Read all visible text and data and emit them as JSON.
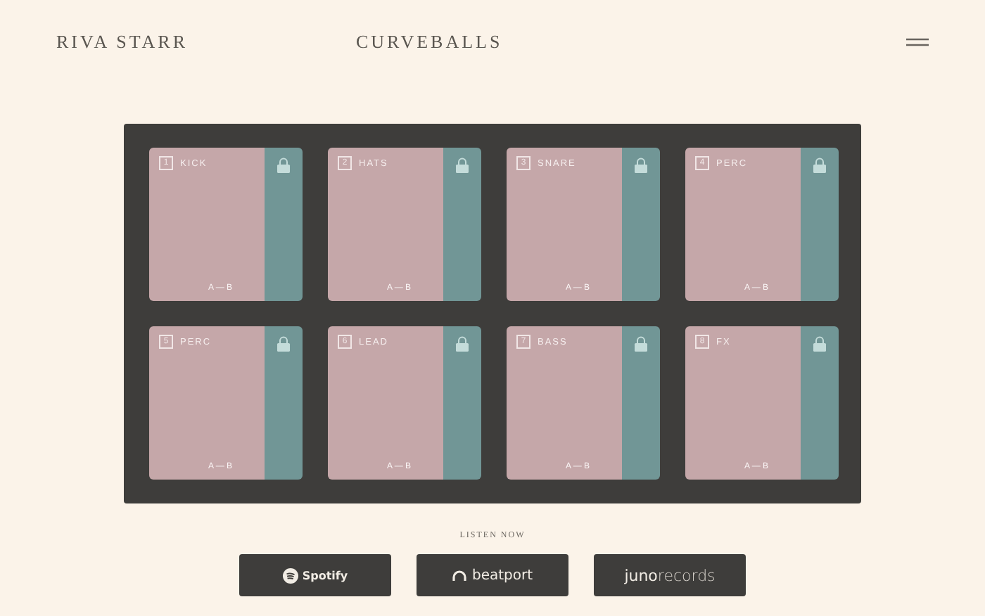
{
  "header": {
    "artist": "RIVA STARR",
    "title": "CURVEBALLS"
  },
  "pads": [
    {
      "number": "1",
      "label": "KICK",
      "footer": "A — B"
    },
    {
      "number": "2",
      "label": "HATS",
      "footer": "A — B"
    },
    {
      "number": "3",
      "label": "SNARE",
      "footer": "A — B"
    },
    {
      "number": "4",
      "label": "PERC",
      "footer": "A — B"
    },
    {
      "number": "5",
      "label": "PERC",
      "footer": "A — B"
    },
    {
      "number": "6",
      "label": "LEAD",
      "footer": "A — B"
    },
    {
      "number": "7",
      "label": "BASS",
      "footer": "A — B"
    },
    {
      "number": "8",
      "label": "FX",
      "footer": "A — B"
    }
  ],
  "listen": {
    "heading": "LISTEN NOW",
    "buttons": [
      {
        "kind": "spotify",
        "label": "Spotify"
      },
      {
        "kind": "beatport",
        "label": "beatport"
      },
      {
        "kind": "juno",
        "label": "**juno**records"
      }
    ]
  }
}
